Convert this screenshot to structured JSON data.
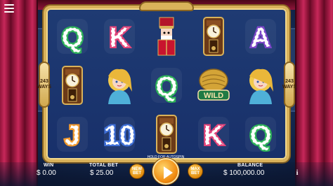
{
  "reels": [
    [
      {
        "symbol": "q-candy",
        "icon": "candy-q-icon"
      },
      {
        "symbol": "grandfather-clock",
        "icon": "clock-icon"
      },
      {
        "symbol": "j-candy",
        "icon": "candy-j-icon"
      }
    ],
    [
      {
        "symbol": "k-candy",
        "icon": "candy-k-icon"
      },
      {
        "symbol": "princess",
        "icon": "princess-icon"
      },
      {
        "symbol": "10-candy",
        "icon": "candy-10-icon"
      }
    ],
    [
      {
        "symbol": "nutcracker",
        "icon": "nutcracker-icon"
      },
      {
        "symbol": "q-candy",
        "icon": "candy-q-icon"
      },
      {
        "symbol": "grandfather-clock",
        "icon": "clock-icon"
      }
    ],
    [
      {
        "symbol": "grandfather-clock",
        "icon": "clock-icon"
      },
      {
        "symbol": "wild",
        "icon": "wild-icon",
        "label": "WILD"
      },
      {
        "symbol": "k-candy",
        "icon": "candy-k-icon"
      }
    ],
    [
      {
        "symbol": "a-candy",
        "icon": "candy-a-icon"
      },
      {
        "symbol": "princess",
        "icon": "princess-icon"
      },
      {
        "symbol": "q-candy",
        "icon": "candy-q-icon"
      }
    ]
  ],
  "ways": {
    "count": "243",
    "label": "WAYS"
  },
  "stats": {
    "win_label": "WIN",
    "win_value": "$ 0.00",
    "bet_label": "TOTAL BET",
    "bet_value": "$ 25.00",
    "balance_label": "BALANCE",
    "balance_value": "$ 100,000.00"
  },
  "buttons": {
    "new_bet_line1": "NEW",
    "new_bet_line2": "BET",
    "max_bet_line1": "MAX",
    "max_bet_line2": "BET",
    "spin_hint": "HOLD FOR AUTOSPIN",
    "info": "i"
  },
  "colors": {
    "frame_gold": "#d9b25a",
    "curtain_red": "#a31a44",
    "spin_orange": "#f08a10",
    "candy_green": "#2fb35a",
    "candy_pink": "#e2457a",
    "candy_blue": "#3f6fd6",
    "candy_purple": "#7b46c8"
  }
}
